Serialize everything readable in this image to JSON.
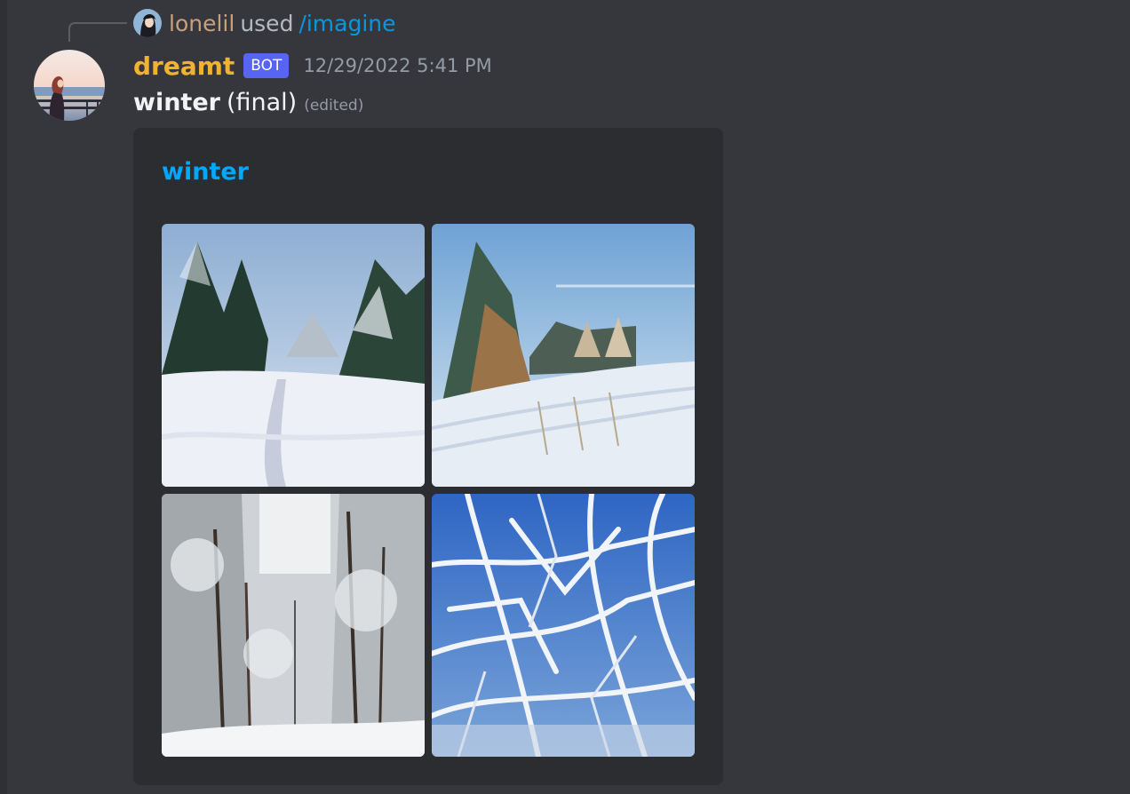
{
  "reply": {
    "username": "lonelil",
    "used_label": "used",
    "command": "/imagine"
  },
  "message": {
    "username": "dreamt",
    "badge": "BOT",
    "timestamp": "12/29/2022 5:41 PM",
    "content_bold": "winter",
    "content_rest": "(final)",
    "edited": "(edited)"
  },
  "embed": {
    "title": "winter",
    "images": [
      {
        "icon": "snowy-pine-path-image"
      },
      {
        "icon": "frosty-field-image"
      },
      {
        "icon": "snow-forest-image"
      },
      {
        "icon": "frosted-branches-image"
      }
    ]
  },
  "colors": {
    "background": "#36373d",
    "embed_bg": "#2b2d31",
    "username": "#f0b232",
    "bot_badge": "#5865f2",
    "link": "#00a8fc",
    "reply_user": "#c8a07c"
  }
}
